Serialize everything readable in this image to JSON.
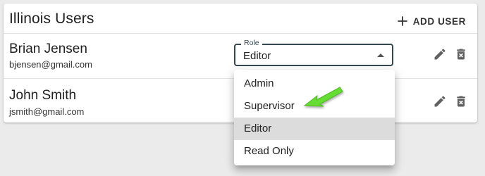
{
  "card": {
    "title": "Illinois Users",
    "add_user_label": "ADD USER"
  },
  "users": [
    {
      "name": "Brian Jensen",
      "email": "bjensen@gmail.com"
    },
    {
      "name": "John Smith",
      "email": "jsmith@gmail.com"
    }
  ],
  "role_field": {
    "legend": "Role",
    "value": "Editor"
  },
  "role_menu": {
    "options": [
      "Admin",
      "Supervisor",
      "Editor",
      "Read Only"
    ],
    "selected": "Editor"
  },
  "icons": {
    "add": "plus-icon",
    "edit": "pencil-icon",
    "delete": "trash-icon",
    "dropdown": "caret-up-icon",
    "annotation": "green-arrow-icon"
  },
  "colors": {
    "page_background": "#ebebeb",
    "card_background": "#ffffff",
    "field_border": "#37474f",
    "selected_option": "#dcdcdc",
    "icon_color": "#616161",
    "annotation_arrow": "#66dd33"
  }
}
